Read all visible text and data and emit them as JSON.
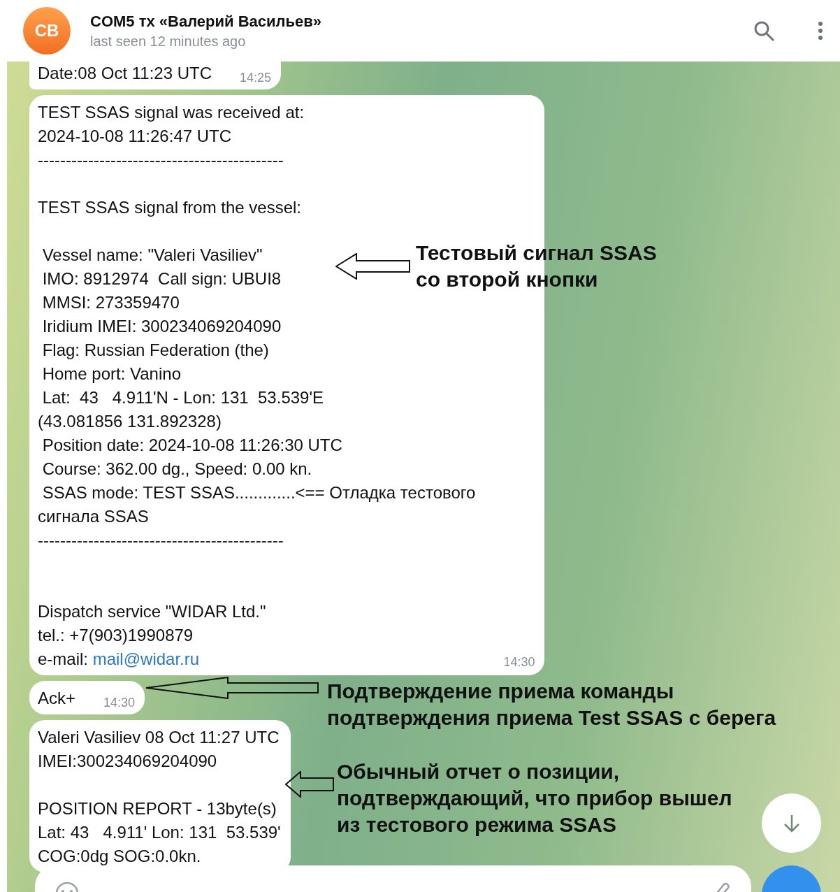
{
  "header": {
    "avatar_initials": "CB",
    "title": "COM5 тх «Валерий Васильев»",
    "status": "last seen 12 minutes ago"
  },
  "messages": [
    {
      "paragraphs": [
        {
          "kind": "body",
          "lines": [
            "Date:08 Oct 11:23 UTC"
          ]
        }
      ],
      "time": "14:25"
    },
    {
      "paragraphs": [
        {
          "kind": "body",
          "lines": [
            "TEST SSAS signal was received at:",
            "2024-10-08 11:26:47 UTC",
            "--------------------------------------------"
          ]
        },
        {
          "kind": "body",
          "lines": [
            "TEST SSAS signal from the vessel:"
          ]
        },
        {
          "kind": "body",
          "lines": [
            " Vessel name: \"Valeri Vasiliev\"",
            " IMO: 8912974  Call sign: UBUI8",
            " MMSI: 273359470",
            " Iridium IMEI: 300234069204090",
            " Flag: Russian Federation (the)",
            " Home port: Vanino",
            " Lat:  43   4.911'N - Lon: 131  53.539'E",
            "(43.081856 131.892328)",
            " Position date: 2024-10-08 11:26:30 UTC",
            " Course: 362.00 dg., Speed: 0.00 kn.",
            " SSAS mode: TEST SSAS.............<== Отладка тестового",
            "сигнала SSAS",
            "--------------------------------------------"
          ]
        },
        {
          "kind": "footer",
          "lines": [
            "Dispatch service \"WIDAR Ltd.\"",
            "tel.: +7(903)1990879",
            {
              "text": "e-mail: ",
              "link": "mail@widar.ru"
            }
          ]
        }
      ],
      "time": "14:30"
    },
    {
      "paragraphs": [
        {
          "kind": "body",
          "lines": [
            "Ack+"
          ]
        }
      ],
      "time": "14:30"
    },
    {
      "paragraphs": [
        {
          "kind": "body",
          "lines": [
            "Valeri Vasiliev 08 Oct 11:27 UTC",
            "IMEI:300234069204090"
          ]
        },
        {
          "kind": "body",
          "lines": [
            "POSITION REPORT - 13byte(s)",
            "Lat: 43   4.911' Lon: 131  53.539'",
            "COG:0dg SOG:0.0kn."
          ]
        }
      ]
    }
  ],
  "annotations": [
    {
      "lines": [
        "Тестовый сигнал SSAS",
        "со второй кнопки"
      ]
    },
    {
      "lines": [
        "Подтверждение приема команды",
        "подтверждения приема Test SSAS с берега"
      ]
    },
    {
      "lines": [
        "Обычный отчет о позиции,",
        "подтверждающий, что прибор вышел",
        "из тестового режима SSAS"
      ]
    }
  ]
}
